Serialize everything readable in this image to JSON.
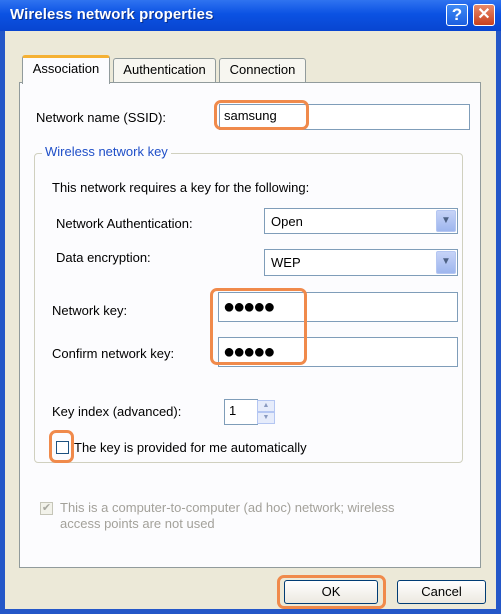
{
  "window": {
    "title": "Wireless network properties",
    "help_label": "?",
    "close_label": "✕"
  },
  "tabs": [
    "Association",
    "Authentication",
    "Connection"
  ],
  "ssid": {
    "label": "Network name (SSID):",
    "value": "samsung"
  },
  "group": {
    "legend": "Wireless network key",
    "intro": "This network requires a key for the following:",
    "auth_label": "Network Authentication:",
    "auth_value": "Open",
    "enc_label": "Data encryption:",
    "enc_value": "WEP",
    "key_label": "Network key:",
    "key_value": "●●●●●",
    "confirm_label": "Confirm network key:",
    "confirm_value": "●●●●●",
    "index_label": "Key index (advanced):",
    "index_value": "1",
    "auto_label": "The key is provided for me automatically"
  },
  "adhoc": {
    "line1": "This is a computer-to-computer (ad hoc) network; wireless",
    "line2": "access points are not used",
    "checked": true
  },
  "buttons": {
    "ok": "OK",
    "cancel": "Cancel"
  },
  "colors": {
    "title_blue": "#0b52e3",
    "highlight": "#f08a4b",
    "legend_blue": "#1f4fc8",
    "face": "#ece9d8"
  },
  "icons": {
    "help": "help-icon",
    "close": "close-icon",
    "dropdown": "chevron-down-icon",
    "check": "checkmark-icon"
  }
}
